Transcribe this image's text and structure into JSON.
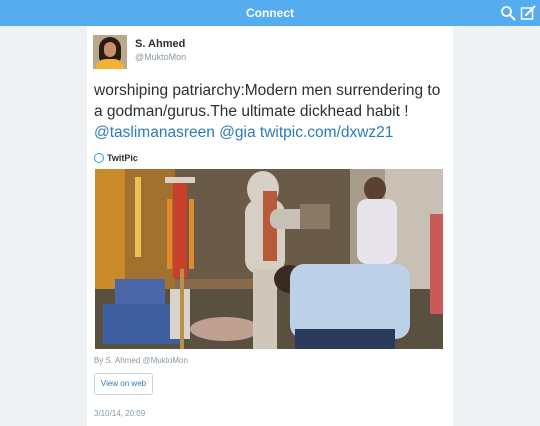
{
  "header": {
    "title": "Connect",
    "search_icon": "search-icon",
    "compose_icon": "compose-icon",
    "bar_color": "#55acee"
  },
  "tweet": {
    "author_name": "S. Ahmed",
    "author_handle": "@MuktoMon",
    "text": "worshiping patriarchy:Modern men surrendering to a godman/gurus.The ultimate dickhead habit !",
    "mention_1": "@taslimanasreen",
    "mention_2": "@gia",
    "link": "twitpic.com/dxwz21",
    "source": "TwitPic",
    "photo_credit": "By S. Ahmed @MuktoMon",
    "view_button": "View on web",
    "timestamp": "3/10/14, 20:09",
    "link_color": "#2b7bb9"
  }
}
